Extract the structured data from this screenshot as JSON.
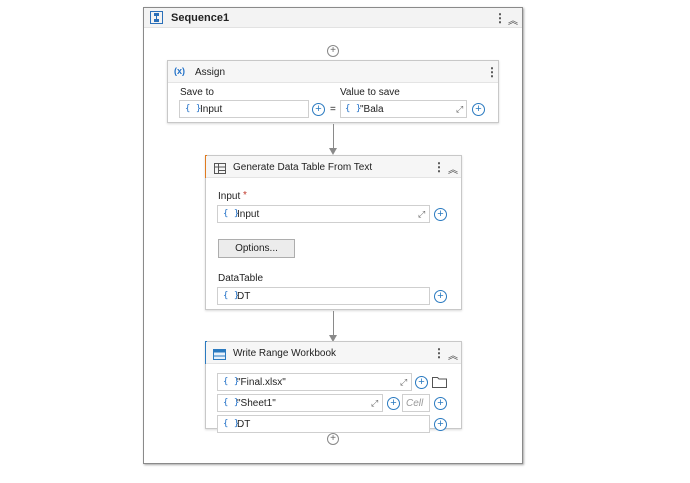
{
  "sequence": {
    "title": "Sequence1",
    "icon": "sequence-icon"
  },
  "assign": {
    "icon_text": "(x)",
    "title": "Assign",
    "save_to_label": "Save to",
    "value_label": "Value to save",
    "save_to_value": "Input",
    "equals": "=",
    "value": "\"Bala"
  },
  "generate": {
    "title": "Generate Data Table From Text",
    "input_label": "Input",
    "required_mark": "*",
    "input_value": "Input",
    "options_button": "Options...",
    "datatable_label": "DataTable",
    "datatable_value": "DT",
    "accent_color": "#e07b1f"
  },
  "write_range": {
    "title": "Write Range Workbook",
    "file_value": "\"Final.xlsx\"",
    "sheet_value": "\"Sheet1\"",
    "cell_placeholder": "Cell",
    "data_value": "DT",
    "accent_color": "#2a7ac0"
  },
  "common": {
    "brace": "{ }",
    "kebab": "⋮",
    "collapse": "︽",
    "plus": "+"
  }
}
